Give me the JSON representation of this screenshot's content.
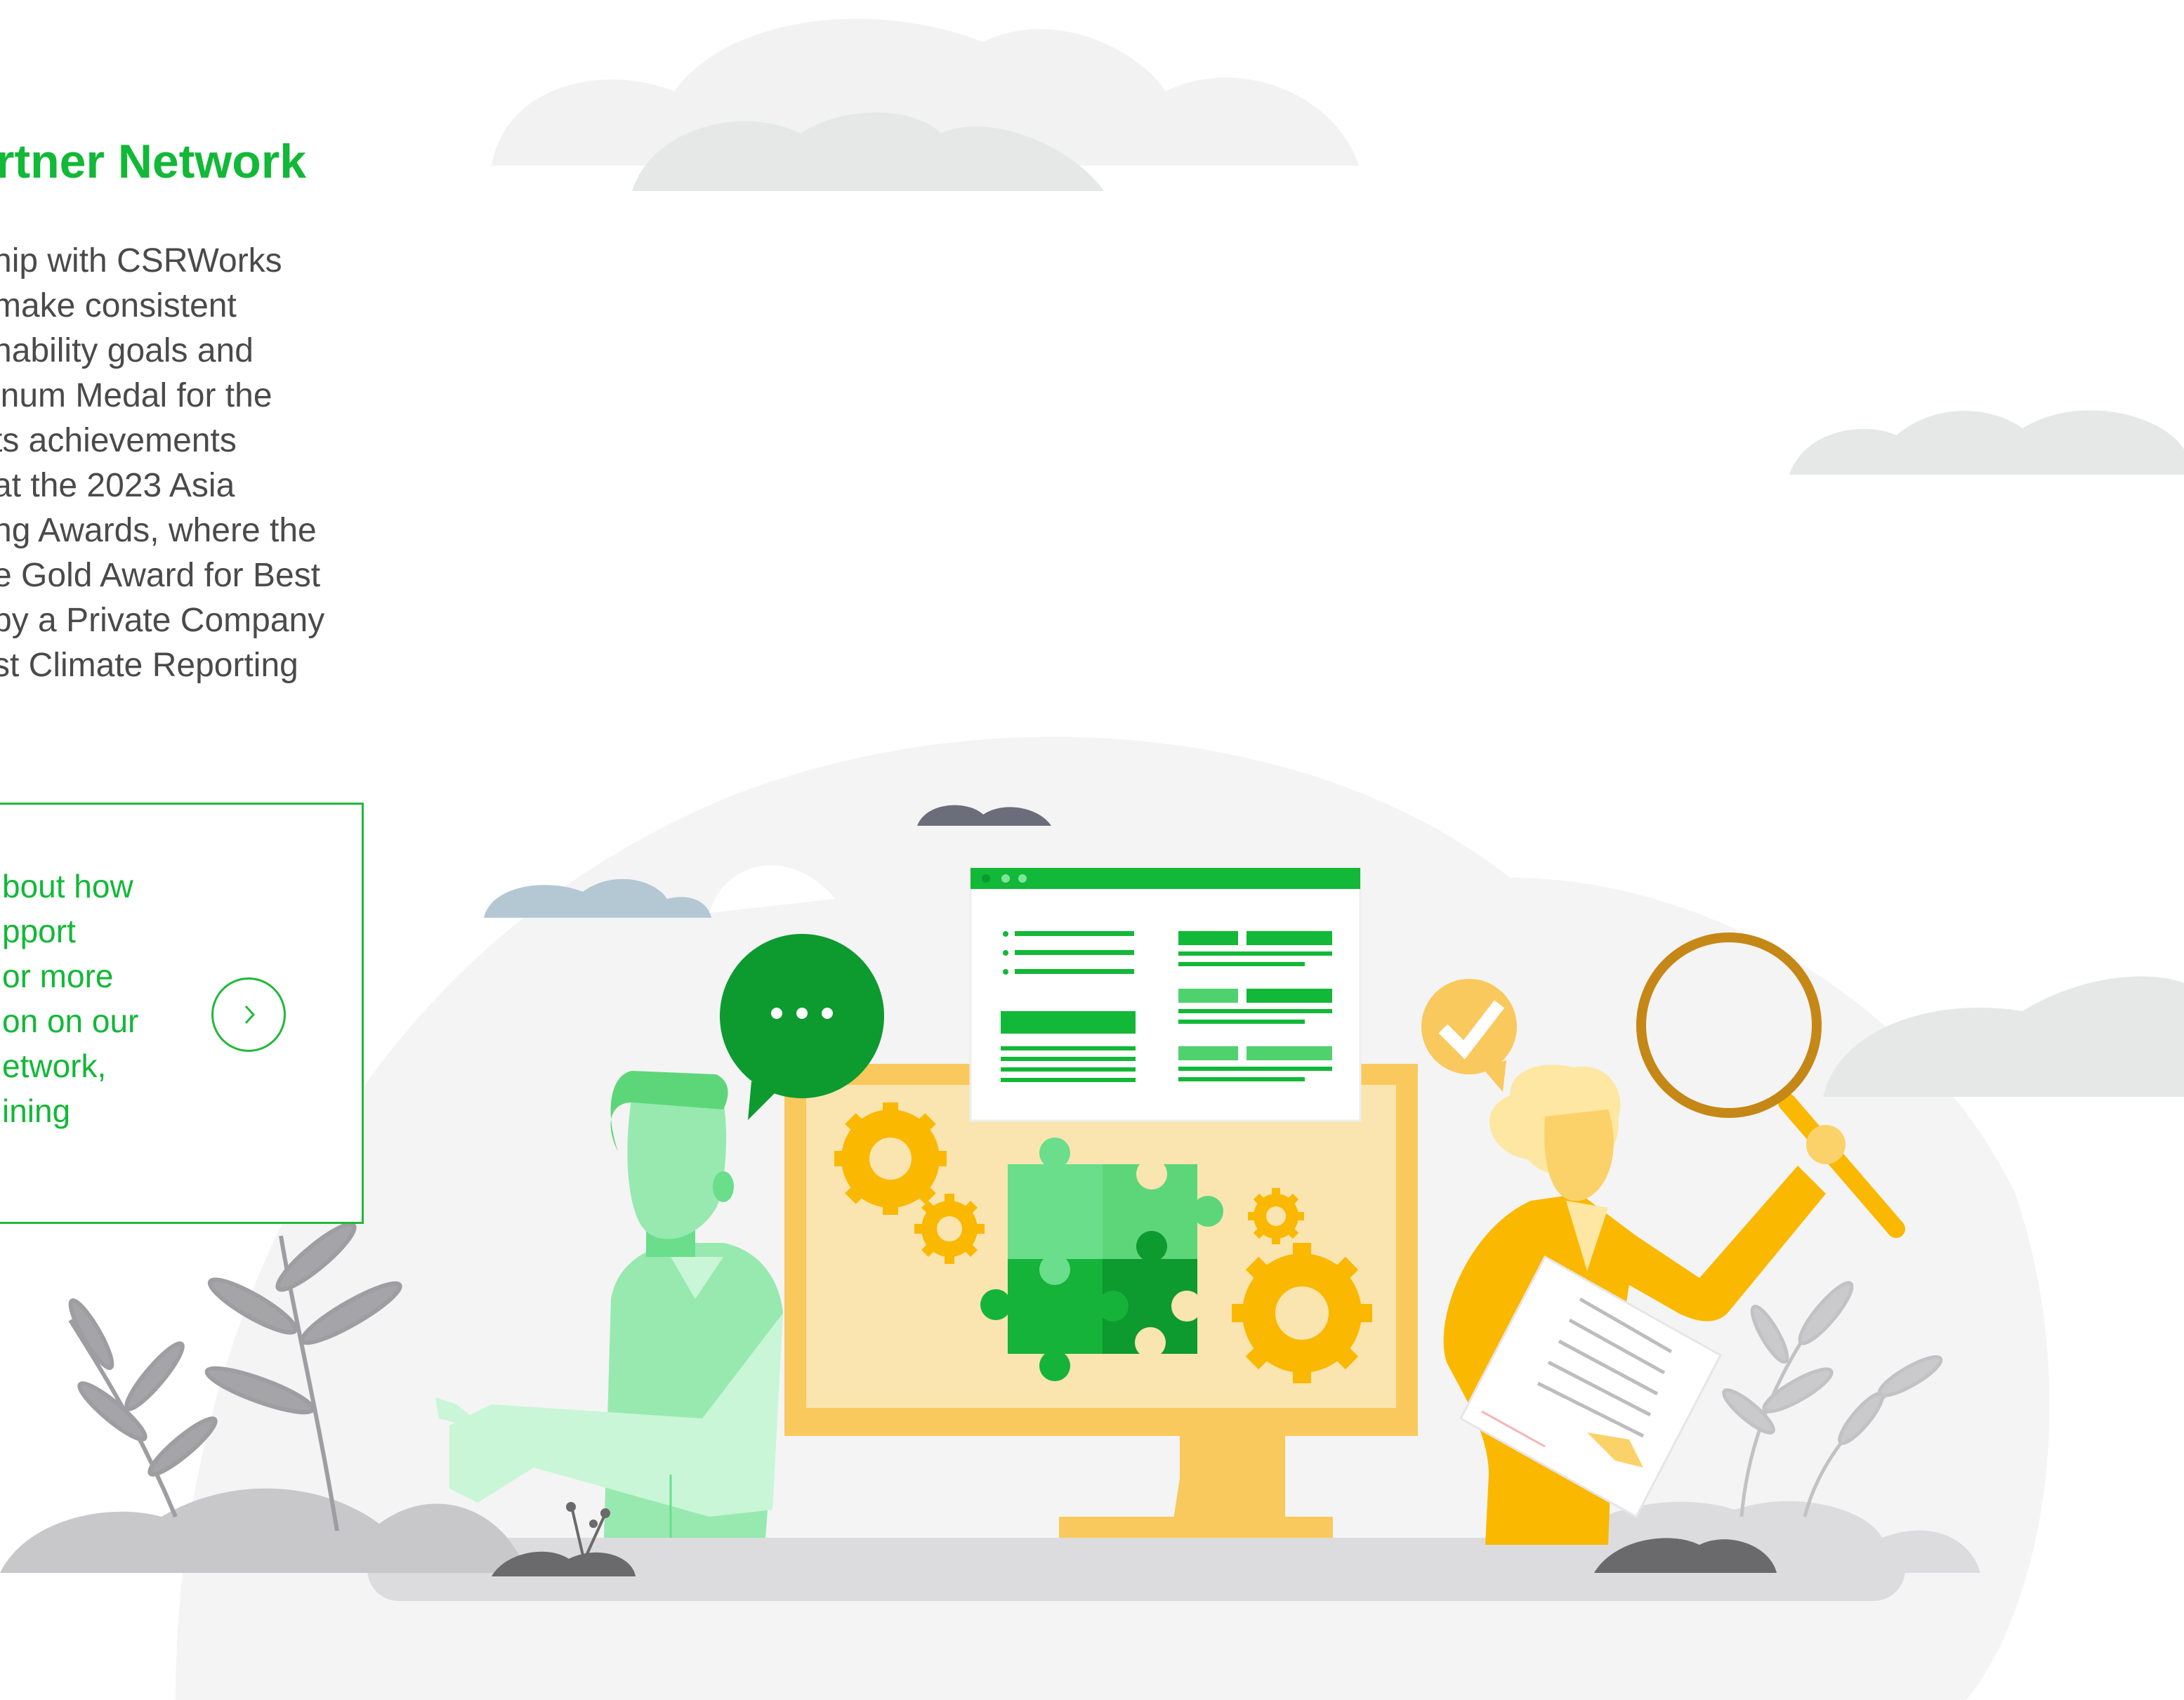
{
  "section": {
    "title": "rtner Network",
    "body_lines": [
      "hip with CSRWorks",
      "make consistent",
      "nability goals and",
      "inum Medal for the",
      "ts achievements",
      "at the 2023 Asia",
      "ng Awards, where the",
      "e Gold Award for Best",
      "by a Private Company",
      "st Climate Reporting"
    ]
  },
  "cta": {
    "lines": [
      "bout how",
      "pport",
      " or more",
      "on on our",
      "etwork,",
      "ining"
    ],
    "arrow_icon": "chevron-right-icon"
  },
  "illustration": {
    "screen_dots_icon": "ellipsis-icon",
    "check_icon": "check-icon",
    "magnifier_icon": "magnifying-glass-icon"
  },
  "colors": {
    "brand_green": "#12b837",
    "text_gray": "#4a4a4a",
    "yellow": "#fbb800",
    "light_yellow": "#f9e5b0"
  }
}
